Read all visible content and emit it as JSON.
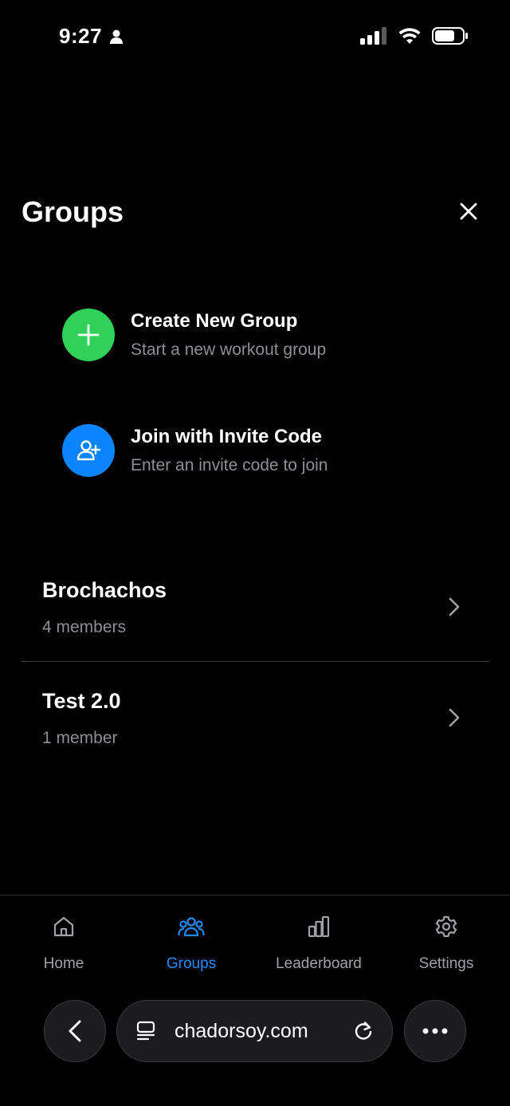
{
  "status_bar": {
    "time": "9:27"
  },
  "header": {
    "title": "Groups"
  },
  "actions": [
    {
      "title": "Create New Group",
      "subtitle": "Start a new workout group",
      "icon": "plus-icon",
      "color": "#30d158"
    },
    {
      "title": "Join with Invite Code",
      "subtitle": "Enter an invite code to join",
      "icon": "user-plus-icon",
      "color": "#0a84ff"
    }
  ],
  "groups": [
    {
      "name": "Brochachos",
      "members": "4 members"
    },
    {
      "name": "Test 2.0",
      "members": "1 member"
    }
  ],
  "tabs": [
    {
      "label": "Home",
      "icon": "home-icon",
      "active": false
    },
    {
      "label": "Groups",
      "icon": "groups-icon",
      "active": true
    },
    {
      "label": "Leaderboard",
      "icon": "leaderboard-icon",
      "active": false
    },
    {
      "label": "Settings",
      "icon": "gear-icon",
      "active": false
    }
  ],
  "browser": {
    "url": "chadorsoy.com"
  },
  "colors": {
    "accent": "#1f8bff",
    "green": "#30d158",
    "blue": "#0a84ff",
    "muted": "#8e8e93"
  }
}
